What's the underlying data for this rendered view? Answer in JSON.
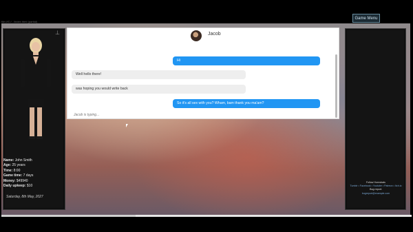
{
  "url_bar": "file:///C:/.../index.html (partial)",
  "menu": {
    "game_menu": "Game Menu"
  },
  "chat": {
    "contact_name": "Jacob",
    "messages": [
      {
        "from": "me",
        "text": "Hi"
      },
      {
        "from": "them",
        "text": "Well hello there!"
      },
      {
        "from": "them",
        "text": "was hoping you would write back"
      },
      {
        "from": "me",
        "text": "So it's all sex with you? Wham, bam thank you ma'am?"
      }
    ],
    "typing": "Jacob is typing..."
  },
  "stats": {
    "name_label": "Name:",
    "name": "John Smith",
    "age_label": "Age:",
    "age": "25 years",
    "time_label": "Time:",
    "time": "8:00",
    "gametime_label": "Game time:",
    "gametime": "7 days",
    "money_label": "Money:",
    "money": "$49940",
    "upkeep_label": "Daily upkeep:",
    "upkeep": "$10",
    "date": "Saturday, 8th May, 2027"
  },
  "follow": {
    "title": "Follow Hornstrats",
    "links": "Tumblr • Facebook • Youtube • Patreon • Itch.io",
    "bug_label": "Bug report:",
    "bug_email": "bugreport@example.com"
  },
  "colors": {
    "bubble_me": "#2196f3",
    "bubble_them": "#eeeeee",
    "panel": "#141414"
  }
}
